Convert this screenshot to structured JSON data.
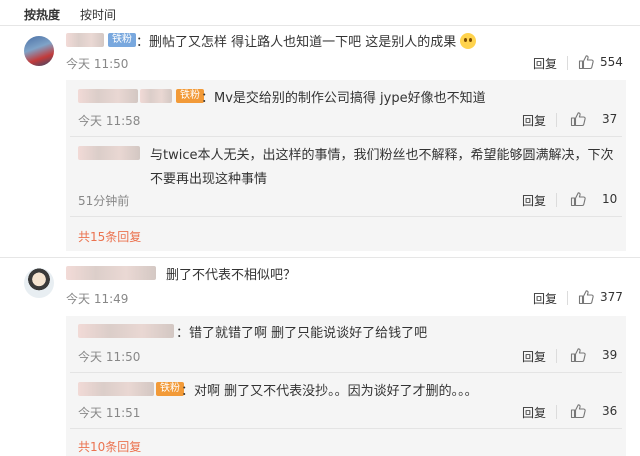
{
  "sort": {
    "hot": "按热度",
    "time": "按时间"
  },
  "reply_label": "回复",
  "comments": [
    {
      "badge": "铁粉",
      "text": "：删帖了又怎样 得让路人也知道一下吧 这是别人的成果",
      "time": "今天 11:50",
      "likes": "554",
      "replies": [
        {
          "badge": "铁粉",
          "text": "：Mv是交给别的制作公司搞得  jype好像也不知道",
          "time": "今天 11:58",
          "likes": "37"
        },
        {
          "text": "与twice本人无关，出这样的事情，我们粉丝也不解释，希望能够圆满解决，下次不要再出现这种事情",
          "time": "51分钟前",
          "likes": "10"
        }
      ],
      "more": "共15条回复"
    },
    {
      "text": "删了不代表不相似吧？",
      "time": "今天 11:49",
      "likes": "377",
      "replies": [
        {
          "text": "：错了就错了啊 删了只能说谈好了给钱了吧",
          "time": "今天 11:50",
          "likes": "39"
        },
        {
          "badge": "铁粉",
          "text": "：对啊 删了又不代表没抄。。因为谈好了才删的。。。",
          "time": "今天 11:51",
          "likes": "36"
        }
      ],
      "more": "共10条回复"
    }
  ],
  "icons": {
    "like": "thumbs-up-icon",
    "emoji": "blush-emoji-icon"
  }
}
